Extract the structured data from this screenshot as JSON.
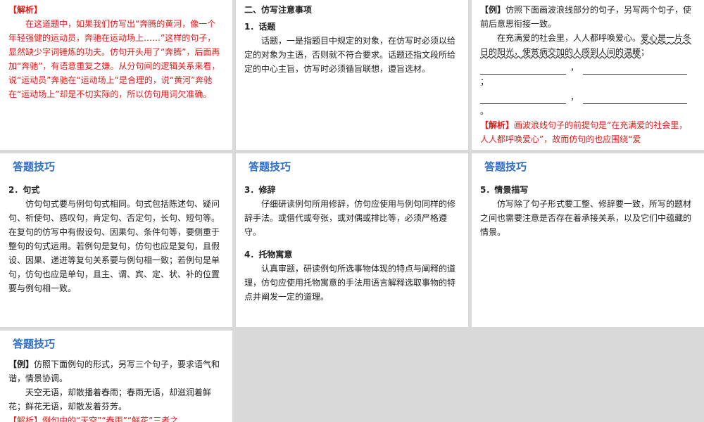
{
  "panel1": {
    "label": "【解析】",
    "text": "在这道题中，如果我们仿写出“奔腾的黄河，像一个年轻强健的运动员，奔驰在运动场上……”这样的句子，显然缺少字词锤炼的功夫。仿句开头用了“奔腾”，后面再加“奔驰”，有语意重复之嫌。从分句间的逻辑关系来看，说“运动员”奔驰在“运动场上”是合理的，说“黄河”奔驰在“运动场上”却是不切实际的，所以仿句用词欠准确。"
  },
  "panel2": {
    "heading": "二、仿写注意事项",
    "sub1": "1．话题",
    "text1": "话题，一是指题目中规定的对象，在仿写时必须以给定的对象为主语，否则就不符合要求。话题还指文段所给定的中心主旨，仿写时必须循旨联想，遵旨选材。"
  },
  "panel3": {
    "example_label": "【例】",
    "example_text": "仿照下面画波浪线部分的句子，另写两个句子，使前后意思衔接一致。",
    "passage_plain": "在充满爱的社会里，人人都呼唤爱心。",
    "passage_wavy": "爱心是一片冬日的阳光，使贫病交加的人感到人间的温暖",
    "passage_end": "；",
    "comma": "，",
    "semicolon": "；",
    "period": "。",
    "analysis_label": "【解析】",
    "analysis_text": "画波浪线句子的前提句是“在充满爱的社会里，人人都呼唤爱心”，故而仿句的也应围绕“爱"
  },
  "panel4": {
    "title": "答题技巧",
    "sub": "2．句式",
    "text": "仿句句式要与例句句式相同。句式包括陈述句、疑问句、祈使句、感叹句，肯定句、否定句，长句、短句等。在复句的仿写中有假设句、因果句、条件句等，要侧重于整句的句式运用。若例句是复句，仿句也应是复句，且假设、因果、递进等复句关系要与例句相一致；若例句是单句，仿句也应是单句，且主、谓、宾、定、状、补的位置要与例句相一致。"
  },
  "panel5": {
    "title": "答题技巧",
    "sub1": "3．修辞",
    "text1": "仔细研读例句所用修辞，仿句应使用与例句同样的修辞手法。或借代或夸张，或对偶或排比等，必须严格遵守。",
    "sub2": "4．托物寓意",
    "text2": "认真审题，研读例句所选事物体现的特点与阐释的道理，仿句应使用托物寓意的手法用语言解释选取事物的特点并阐发一定的道理。"
  },
  "panel6": {
    "title": "答题技巧",
    "sub": "5．情景描写",
    "text": "仿写除了句子形式要工整、修辞要一致，所写的题材之间也需要注意是否存在着承接关系，以及它们中蕴藏的情景。"
  },
  "panel7": {
    "title": "答题技巧",
    "example_label": "【例】",
    "example_text": "仿照下面例句的形式，另写三个句子，要求语气和谐，情景协调。",
    "sample": "天空无语，却散播着春雨；春雨无语，却滋润着鲜花；鲜花无语，却散发着芬芳。",
    "analysis_partial": "【解析】例句中的“天空”“春雨”“鲜花”三者之"
  }
}
